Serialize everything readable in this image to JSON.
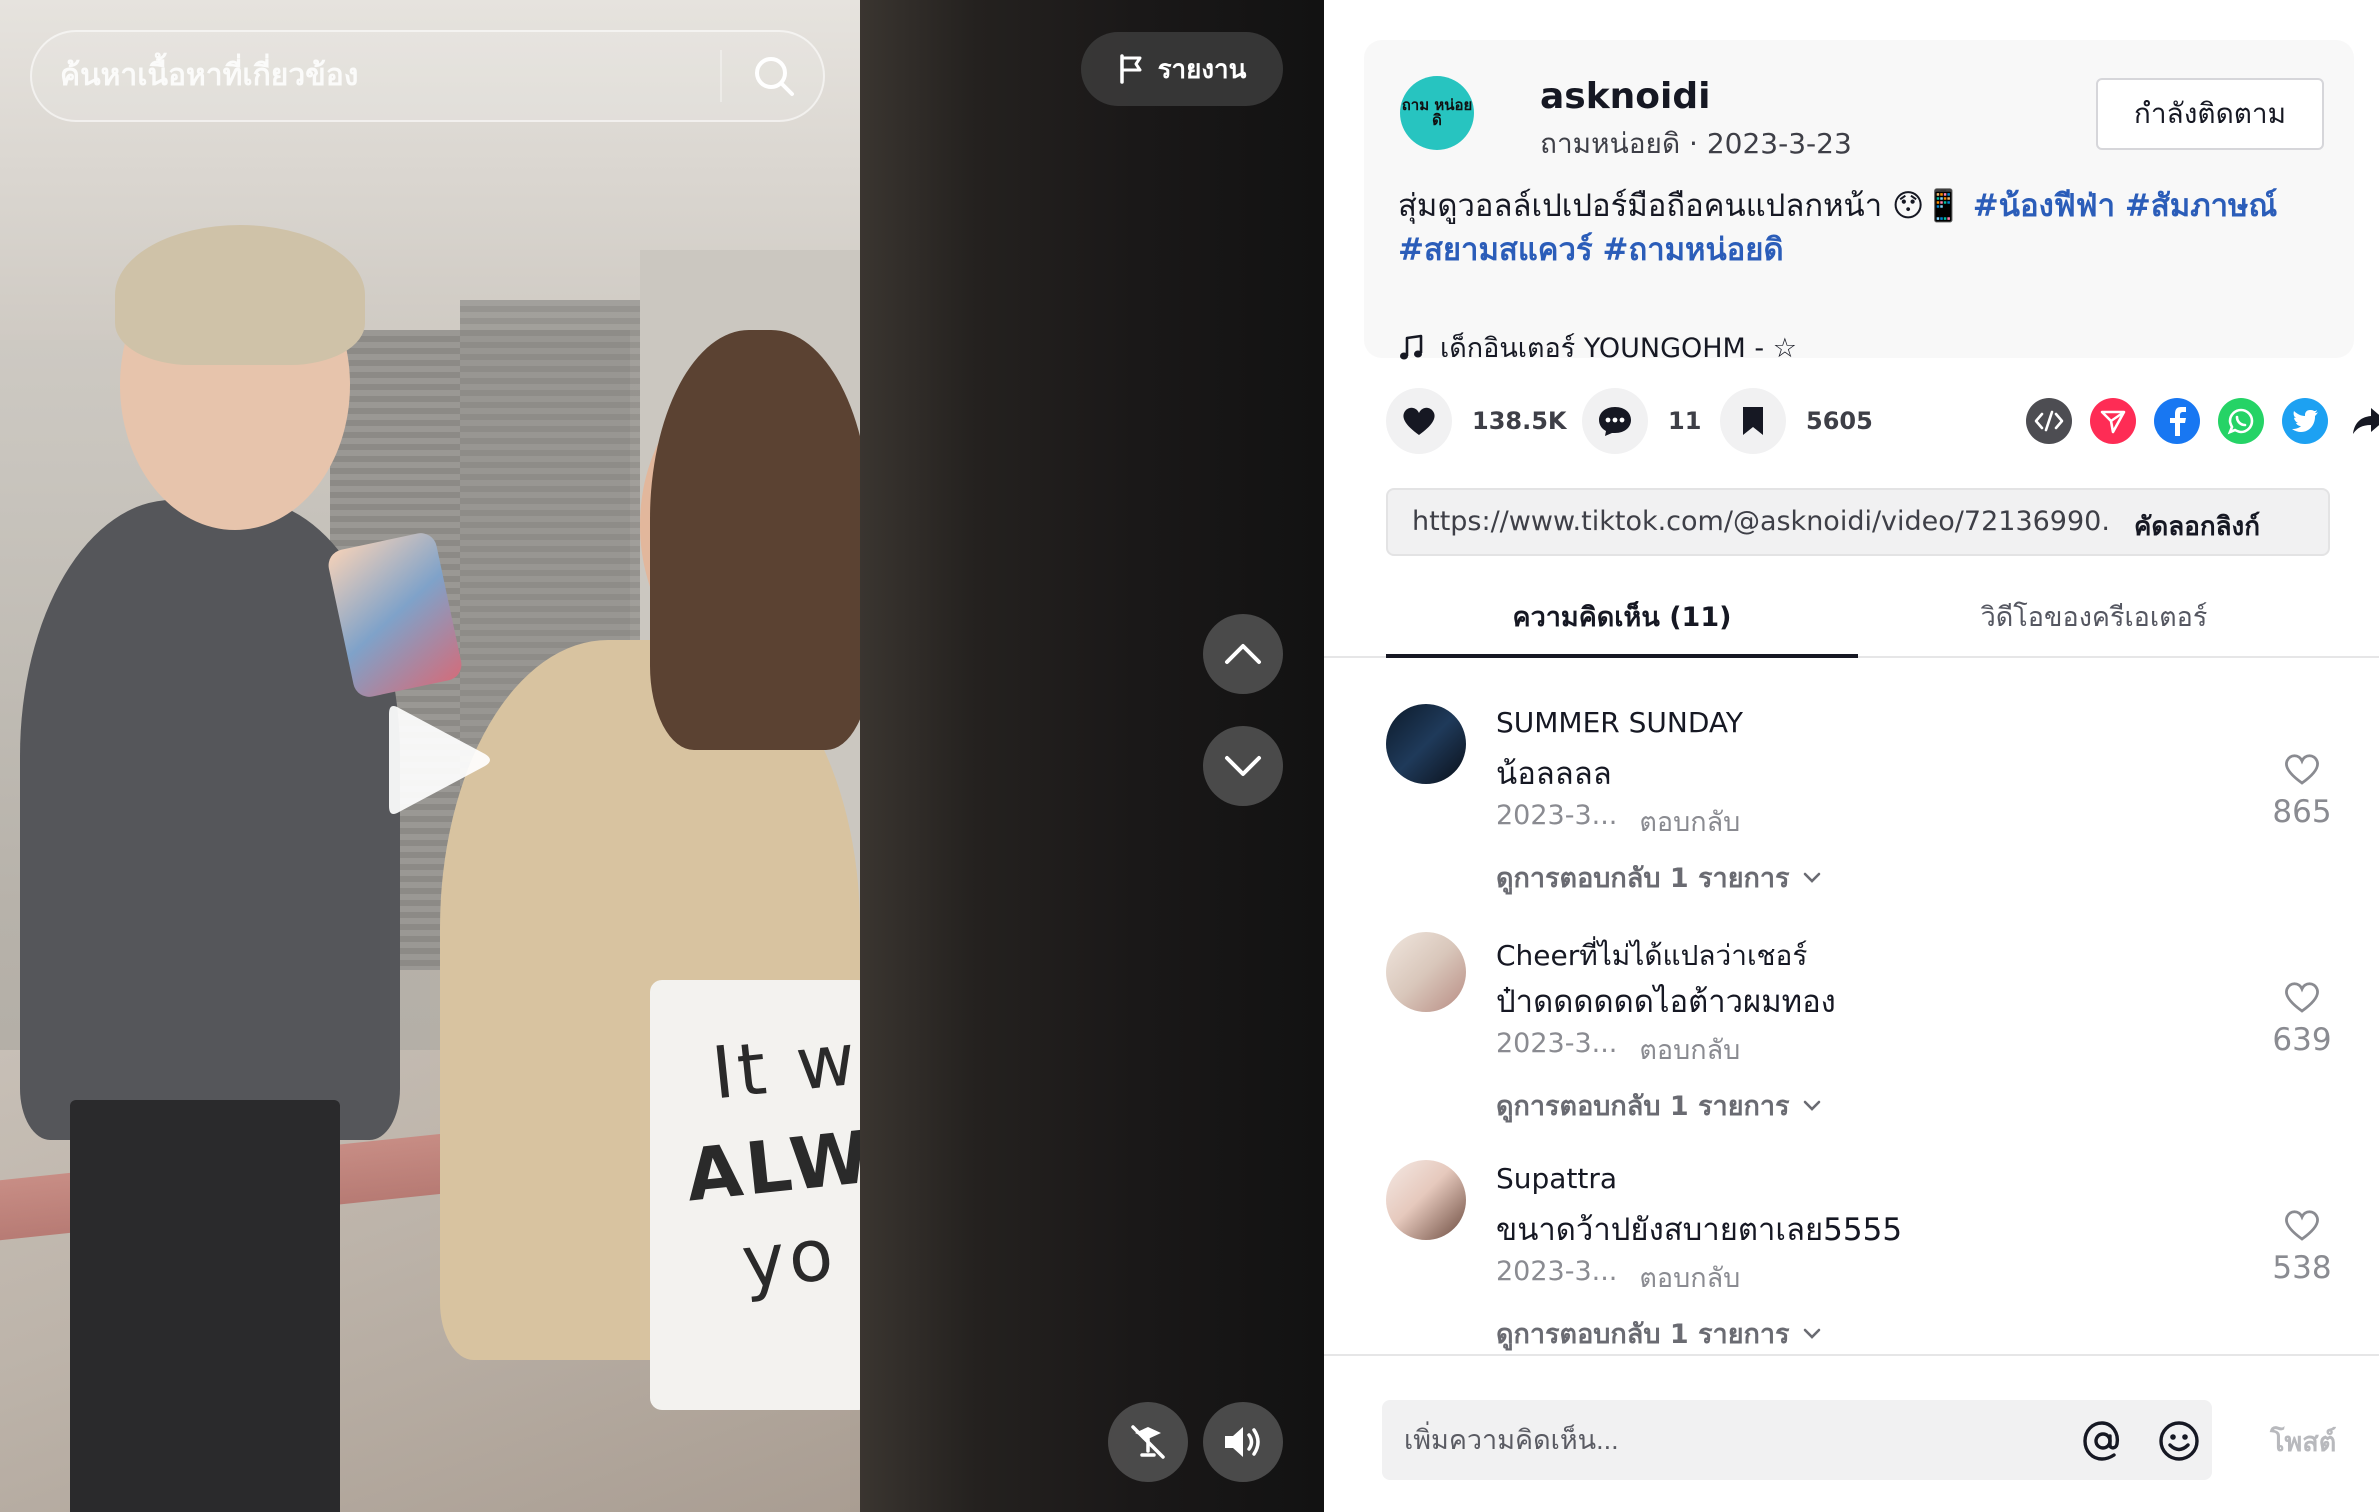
{
  "search": {
    "placeholder": "ค้นหาเนื้อหาที่เกี่ยวข้อง"
  },
  "video": {
    "report_label": "รายงาน",
    "bag_text": [
      "It w",
      "ALW",
      "yo"
    ]
  },
  "author": {
    "avatar_text": "ถาม หน่อย ดิ",
    "username": "asknoidi",
    "nickname": "ถามหน่อยดิ",
    "date": "2023-3-23",
    "follow_label": "กำลังติดตาม"
  },
  "description": {
    "text": "สุ่มดูวอลล์เปเปอร์มือถือคนแปลกหน้า 😯📱",
    "tags": [
      "#น้องฟีฟ่า",
      "#สัมภาษณ์",
      "#สยามสแควร์",
      "#ถามหน่อยดิ"
    ]
  },
  "music": {
    "title": "เด็กอินเตอร์ YOUNGOHM - ☆"
  },
  "stats": {
    "likes": "138.5K",
    "comments": "11",
    "saves": "5605"
  },
  "share": {
    "link": "https://www.tiktok.com/@asknoidi/video/72136990...",
    "copy_label": "คัดลอกลิงก์",
    "colors": {
      "embed": "#4d4d52",
      "send": "#fe2c55",
      "facebook": "#1877f2",
      "whatsapp": "#25d366",
      "twitter": "#1da1f2"
    }
  },
  "tabs": [
    {
      "label": "ความคิดเห็น (11)"
    },
    {
      "label": "วิดีโอของครีเอเตอร์"
    }
  ],
  "comments": [
    {
      "user": "SUMMER SUNDAY",
      "text": "น้อลลลล",
      "date": "2023-3...",
      "reply": "ตอบกลับ",
      "view_replies": "ดูการตอบกลับ 1 รายการ",
      "likes": "865"
    },
    {
      "user": "Cheerที่ไม่ได้แปลว่าเชอร์",
      "text": "ป๋าดดดดดดไอต้าวผมทอง",
      "date": "2023-3...",
      "reply": "ตอบกลับ",
      "view_replies": "ดูการตอบกลับ 1 รายการ",
      "likes": "639"
    },
    {
      "user": "Supattra",
      "text": "ขนาดว้าปยังสบายตาเลย5555",
      "date": "2023-3...",
      "reply": "ตอบกลับ",
      "view_replies": "ดูการตอบกลับ 1 รายการ",
      "likes": "538"
    }
  ],
  "composer": {
    "placeholder": "เพิ่มความคิดเห็น...",
    "post_label": "โพสต์"
  }
}
